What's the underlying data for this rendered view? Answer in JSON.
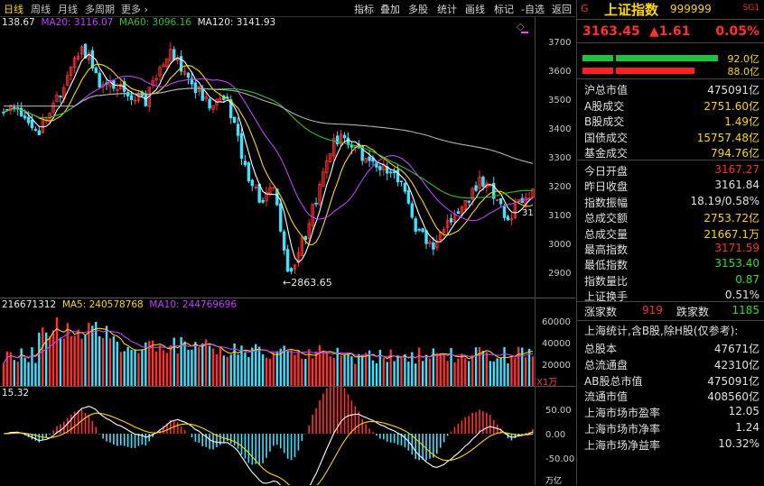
{
  "toolbar": {
    "periods": [
      "日线",
      "周线",
      "月线",
      "多周期",
      "更多 ›"
    ],
    "tools": [
      "指标",
      "叠加",
      "多股",
      "统计",
      "画线",
      "标记",
      "-自选",
      "返回"
    ],
    "nav_prev": "◀",
    "nav_next": "▶"
  },
  "kline": {
    "ma_legend": [
      {
        "label": "138.67",
        "color": "#e8e8e8"
      },
      {
        "label": "MA20: 3116.07",
        "color": "#c040ff"
      },
      {
        "label": "MA60: 3096.16",
        "color": "#30c030"
      },
      {
        "label": "MA120: 3141.93",
        "color": "#e8e8e8"
      }
    ],
    "low_marker": "←2863.65",
    "right_marker": "31",
    "price_axis": [
      "3700",
      "3600",
      "3500",
      "3400",
      "3300",
      "3200",
      "3100",
      "3000",
      "2900"
    ],
    "colors": {
      "up": "#ff3030",
      "down": "#40e0ff",
      "ma5": "#ffffff",
      "ma10": "#ffd700",
      "ma20": "#c040ff",
      "ma60": "#30c030",
      "ma120": "#b0b0b0"
    }
  },
  "volume": {
    "legend": [
      {
        "label": "216671312",
        "color": "#e8e8e8"
      },
      {
        "label": "MA5: 240578768",
        "color": "#ffd700"
      },
      {
        "label": "MA10: 244769696",
        "color": "#c040ff"
      }
    ],
    "axis": [
      "60000",
      "40000",
      "20000"
    ],
    "unit": "X1万"
  },
  "macd": {
    "legend": "15.32",
    "axis": [
      "50.00",
      "0.00",
      "-50.00"
    ]
  },
  "bottom_unit": "万亿",
  "quote": {
    "marker_g": "G",
    "name": "上证指数",
    "code": "999999",
    "tag": "SG1",
    "price": "3163.45",
    "change": "▲1.61",
    "change_pct": "0.05%",
    "bar_top_value": "92.0亿",
    "bar_bottom_value": "88.0亿"
  },
  "market": [
    {
      "k": "沪总市值",
      "v": "475091亿",
      "c": "#e0e0e0"
    },
    {
      "k": "A股成交",
      "v": "2751.60亿",
      "c": "#ffd700"
    },
    {
      "k": "B股成交",
      "v": "1.49亿",
      "c": "#ffd700"
    },
    {
      "k": "国债成交",
      "v": "15757.48亿",
      "c": "#ffd700"
    },
    {
      "k": "基金成交",
      "v": "794.76亿",
      "c": "#ffd700"
    }
  ],
  "stats": [
    {
      "k": "今日开盘",
      "v": "3167.27",
      "c": "#ff3030"
    },
    {
      "k": "昨日收盘",
      "v": "3161.84",
      "c": "#e0e0e0"
    },
    {
      "k": "指数振幅",
      "v": "18.19/0.58%",
      "c": "#e0e0e0"
    },
    {
      "k": "总成交额",
      "v": "2753.72亿",
      "c": "#ffd700"
    },
    {
      "k": "总成交量",
      "v": "21667.1万",
      "c": "#ffd700"
    },
    {
      "k": "最高指数",
      "v": "3171.59",
      "c": "#ff3030"
    },
    {
      "k": "最低指数",
      "v": "3153.40",
      "c": "#30e030"
    },
    {
      "k": "指数量比",
      "v": "0.87",
      "c": "#30e030"
    },
    {
      "k": "上证换手",
      "v": "0.51%",
      "c": "#e0e0e0"
    }
  ],
  "breadth": {
    "up_label": "涨家数",
    "up_value": "919",
    "down_label": "跌家数",
    "down_value": "1185"
  },
  "sh_title": "上海统计,含B股,除H股(仅参考):",
  "sh_stats": [
    {
      "k": "总股本",
      "v": "47671亿"
    },
    {
      "k": "总流通盘",
      "v": "42310亿"
    },
    {
      "k": "AB股总市值",
      "v": "475091亿"
    },
    {
      "k": "流通市值",
      "v": "408560亿"
    },
    {
      "k": "上海市场市盈率",
      "v": "12.05"
    },
    {
      "k": "上海市场市净率",
      "v": "1.24"
    },
    {
      "k": "上海市场净益率",
      "v": "10.32%"
    }
  ]
}
